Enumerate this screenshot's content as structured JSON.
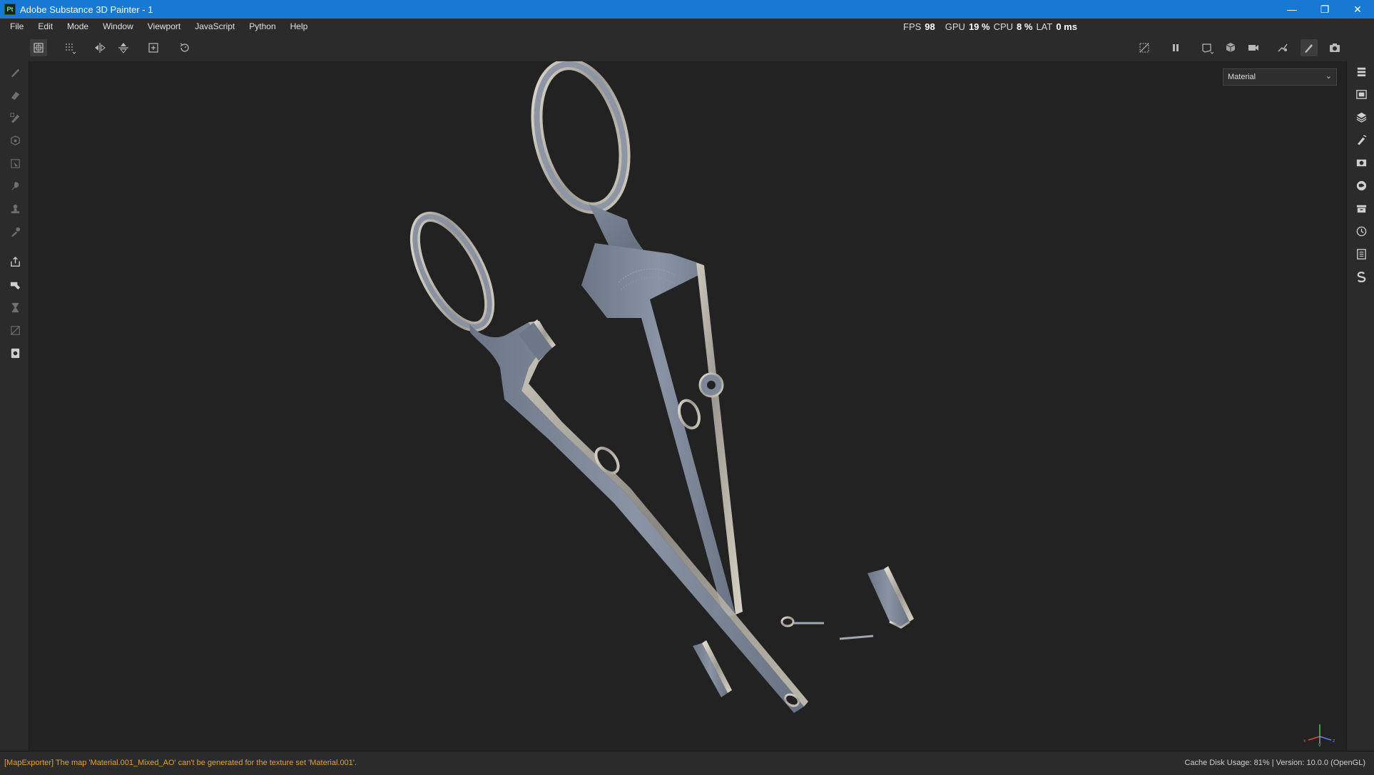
{
  "window": {
    "app_icon_text": "Pt",
    "title": "Adobe Substance 3D Painter - 1",
    "controls": {
      "minimize": "—",
      "restore": "❐",
      "close": "✕"
    }
  },
  "menu": {
    "items": [
      "File",
      "Edit",
      "Mode",
      "Window",
      "Viewport",
      "JavaScript",
      "Python",
      "Help"
    ]
  },
  "perf": {
    "fps_label": "FPS",
    "fps_value": "98",
    "gpu_label": "GPU",
    "gpu_value": "19 %",
    "cpu_label": "CPU",
    "cpu_value": "8 %",
    "lat_label": "LAT",
    "lat_value": "0 ms"
  },
  "toolbar": {
    "left_tools": [
      "selection-mode-icon",
      "grid-select-icon",
      "mirror-x-icon",
      "mirror-y-icon",
      "add-icon",
      "reset-icon"
    ],
    "right_tools": [
      "hide-ui-icon",
      "pause-icon",
      "view-frame-icon",
      "cube-icon",
      "camera-icon",
      "bake-icon",
      "paint-icon",
      "screenshot-icon"
    ]
  },
  "left_tools": [
    "paint-brush-icon",
    "eraser-icon",
    "projection-icon",
    "geometry-fill-icon",
    "polygon-fill-icon",
    "smudge-icon",
    "clone-icon",
    "color-picker-icon",
    "export-icon",
    "bake-tool-icon",
    "hourglass-icon",
    "uv-icon",
    "texture-icon"
  ],
  "right_tools": [
    "texture-set-list-icon",
    "texture-set-settings-icon",
    "layers-icon",
    "properties-icon",
    "display-settings-icon",
    "shader-settings-icon",
    "assets-icon",
    "history-icon",
    "log-icon",
    "substance-icon"
  ],
  "viewport": {
    "mode_label": "Material",
    "gizmo_axes": [
      "x",
      "y",
      "z"
    ],
    "gizmo_colors": {
      "x": "#d24b4b",
      "y": "#4bbf4b",
      "z": "#5b7cf0"
    }
  },
  "status": {
    "message": "[MapExporter] The map 'Material.001_Mixed_AO' can't be generated for the texture set 'Material.001'.",
    "cache_usage": "Cache Disk Usage:    81% | Version: 10.0.0 (OpenGL)"
  },
  "colors": {
    "title_bar": "#1779d4",
    "warning_text": "#e6a12a",
    "panel": "#2b2b2b",
    "viewport_bg": "#222222"
  }
}
